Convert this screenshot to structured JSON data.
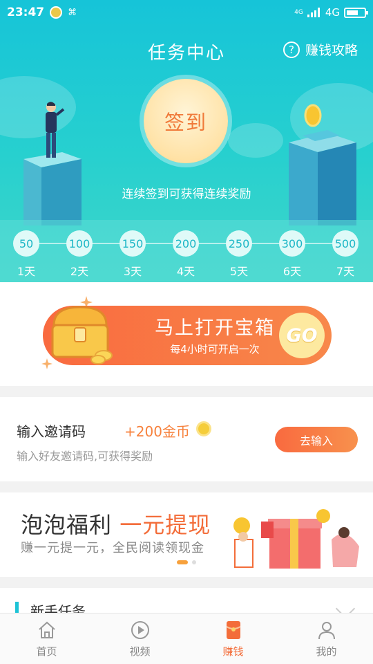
{
  "status_bar": {
    "time": "23:47",
    "network": "4G",
    "network_small": "4G"
  },
  "header": {
    "title": "任务中心",
    "guide_label": "赚钱攻略"
  },
  "signin": {
    "button_label": "签到",
    "tip": "连续签到可获得连续奖励"
  },
  "days": [
    {
      "coins": "50",
      "label": "1天"
    },
    {
      "coins": "100",
      "label": "2天"
    },
    {
      "coins": "150",
      "label": "3天"
    },
    {
      "coins": "200",
      "label": "4天"
    },
    {
      "coins": "250",
      "label": "5天"
    },
    {
      "coins": "300",
      "label": "6天"
    },
    {
      "coins": "500",
      "label": "7天"
    }
  ],
  "treasure": {
    "title": "马上打开宝箱",
    "subtitle": "每4小时可开启一次",
    "go_label": "GO"
  },
  "invite": {
    "title": "输入邀请码",
    "reward": "+200金币",
    "subtitle": "输入好友邀请码,可获得奖励",
    "button_label": "去输入"
  },
  "banner": {
    "title_prefix": "泡泡福利",
    "title_highlight": "一元提现",
    "subtitle": "赚一元提一元，全民阅读领现金"
  },
  "newbie": {
    "title": "新手任务"
  },
  "tabs": [
    {
      "label": "首页",
      "icon": "home-icon",
      "active": false
    },
    {
      "label": "视频",
      "icon": "play-icon",
      "active": false
    },
    {
      "label": "赚钱",
      "icon": "redpacket-icon",
      "active": true
    },
    {
      "label": "我的",
      "icon": "user-icon",
      "active": false
    }
  ],
  "colors": {
    "accent_cyan": "#1dc3d6",
    "accent_orange": "#f36d3a",
    "gold": "#f5cd3a"
  }
}
